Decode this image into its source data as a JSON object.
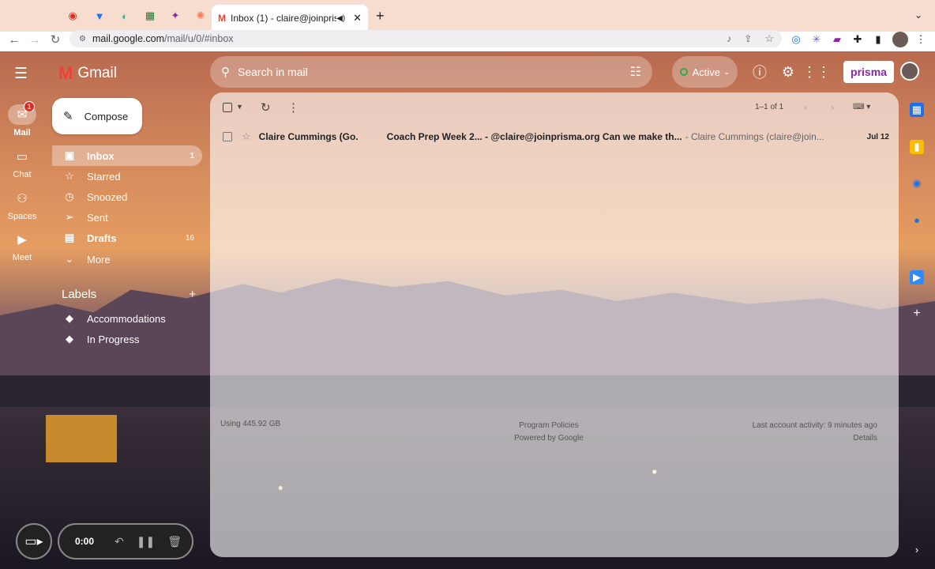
{
  "browser": {
    "active_tab_title": "Inbox (1) - claire@joinprisma",
    "url_host": "mail.google.com",
    "url_path": "/mail/u/0/#inbox",
    "pinned_tab_icons": [
      "record-icon",
      "vpn-icon",
      "grammarly-icon",
      "calendar-icon",
      "star-app-icon",
      "hubspot-icon"
    ],
    "extensions": [
      "loom-icon",
      "asterisk-extension-icon",
      "meta-extension-icon",
      "puzzle-icon",
      "sidepanel-icon",
      "profile-avatar"
    ]
  },
  "rail": {
    "mail": "Mail",
    "mail_badge": "1",
    "chat": "Chat",
    "spaces": "Spaces",
    "meet": "Meet"
  },
  "app": {
    "logo_text": "Gmail"
  },
  "search": {
    "placeholder": "Search in mail"
  },
  "status": {
    "label": "Active"
  },
  "brand": {
    "label": "prisma"
  },
  "compose": {
    "label": "Compose"
  },
  "nav": [
    {
      "label": "Inbox",
      "count": "1",
      "icon": "inbox-icon"
    },
    {
      "label": "Starred",
      "count": "",
      "icon": "star-icon"
    },
    {
      "label": "Snoozed",
      "count": "",
      "icon": "clock-icon"
    },
    {
      "label": "Sent",
      "count": "",
      "icon": "send-icon"
    },
    {
      "label": "Drafts",
      "count": "16",
      "icon": "draft-icon"
    },
    {
      "label": "More",
      "count": "",
      "icon": "chevron-down-icon"
    }
  ],
  "labels": {
    "heading": "Labels",
    "items": [
      "Accommodations",
      "In Progress"
    ]
  },
  "toolbar": {
    "pagination": "1–1 of 1"
  },
  "emails": [
    {
      "sender": "Claire Cummings (Go.",
      "subject": "Coach Prep Week 2... - @claire@joinprisma.org Can we make th...",
      "snippet": "- Claire Cummings (claire@join...",
      "date": "Jul 12"
    }
  ],
  "footer": {
    "storage": "Using 445.92 GB",
    "program_policies": "Program Policies",
    "powered_by": "Powered by Google",
    "last_activity": "Last account activity: 9 minutes ago",
    "details": "Details"
  },
  "recorder": {
    "time": "0:00"
  }
}
